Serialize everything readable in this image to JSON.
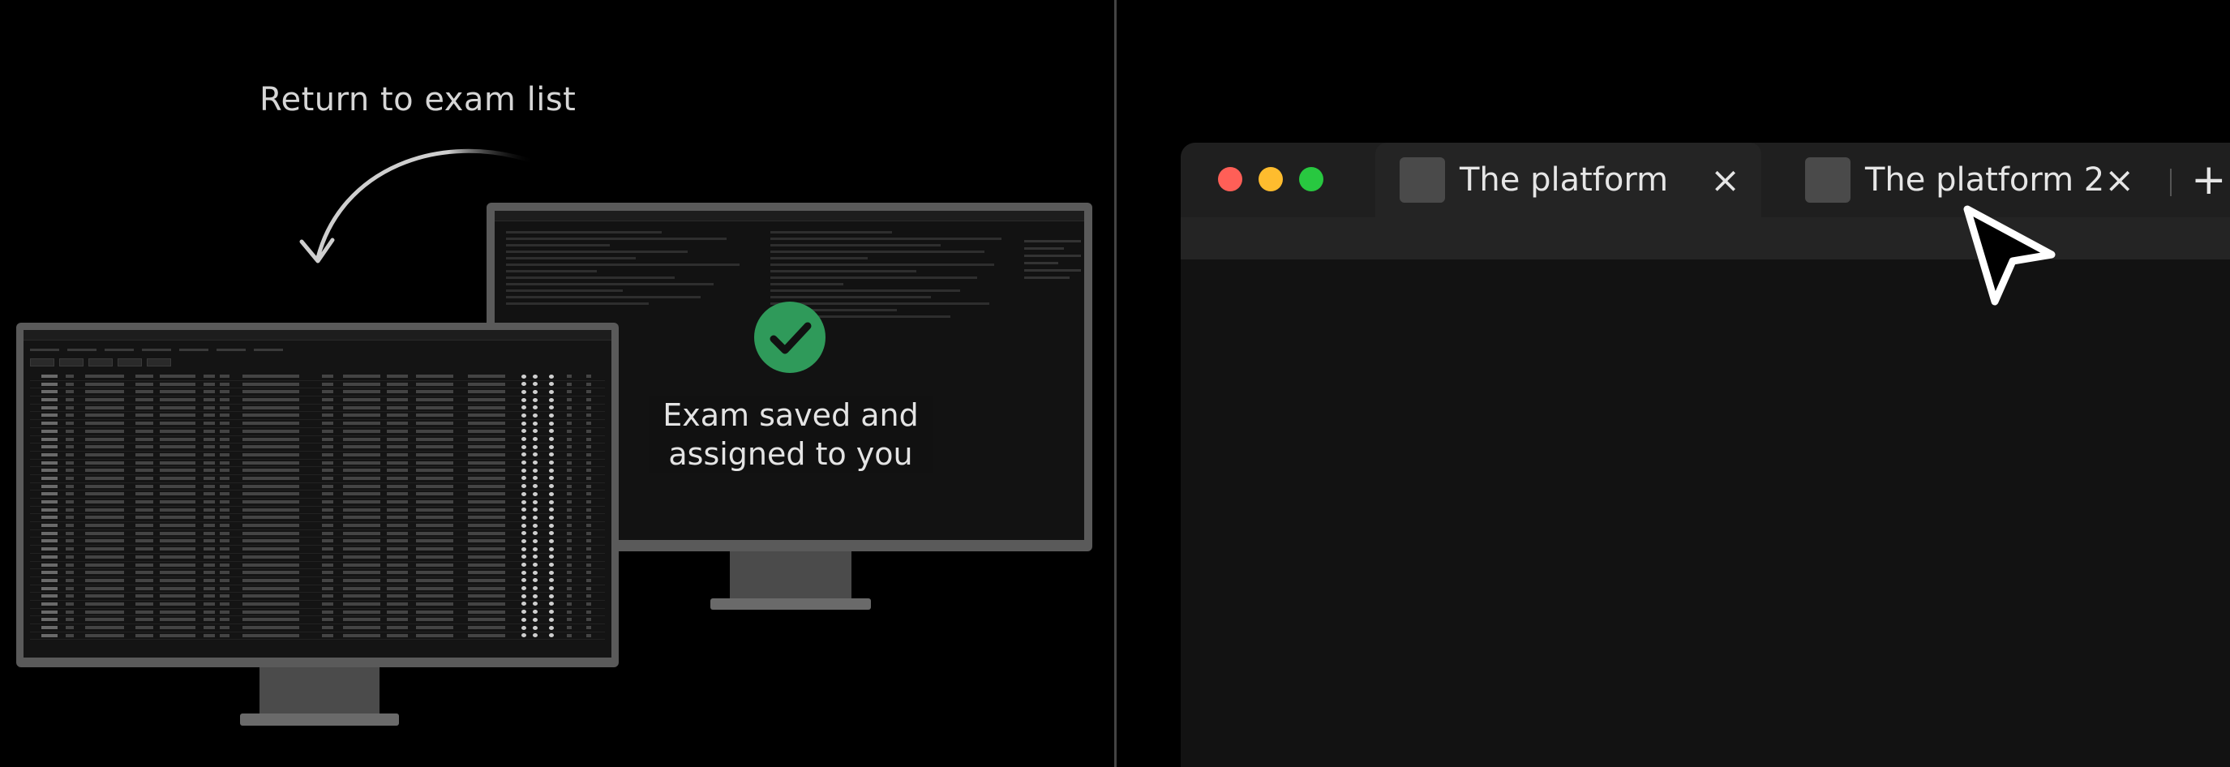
{
  "left_panel": {
    "return_caption": "Return to exam list",
    "saved_caption_line1": "Exam saved and",
    "saved_caption_line2": "assigned to you",
    "check_icon_color": "#2f9a5a"
  },
  "browser": {
    "traffic_lights": [
      "#ff5f57",
      "#febc2e",
      "#28c840"
    ],
    "tabs": [
      {
        "title": "The platform",
        "close": "×",
        "active": true
      },
      {
        "title": "The platform 2",
        "close": "×",
        "active": false
      }
    ],
    "new_tab_label": "+"
  }
}
